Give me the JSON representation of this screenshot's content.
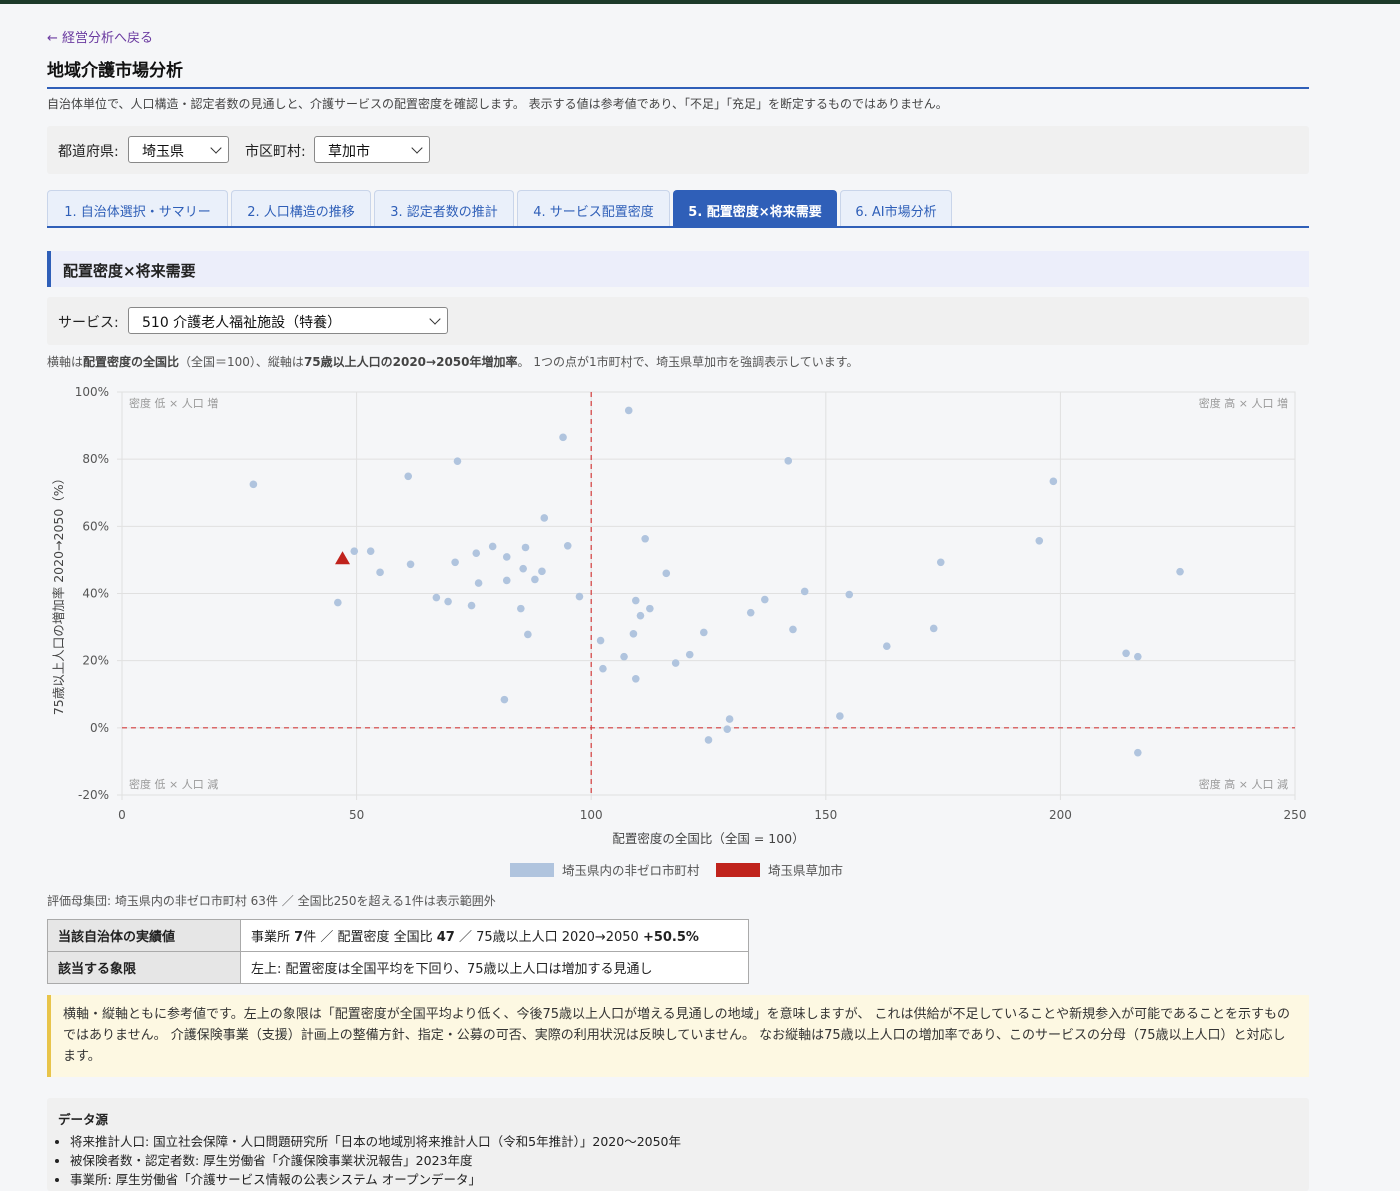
{
  "nav": {
    "back_link": "← 経営分析へ戻る"
  },
  "page": {
    "title": "地域介護市場分析",
    "description": "自治体単位で、人口構造・認定者数の見通しと、介護サービスの配置密度を確認します。 表示する値は参考値であり、「不足」「充足」を断定するものではありません。"
  },
  "selectors": {
    "prefecture_label": "都道府県:",
    "prefecture_value": "埼玉県",
    "municipality_label": "市区町村:",
    "municipality_value": "草加市"
  },
  "tabs": [
    {
      "label": "1. 自治体選択・サマリー",
      "active": false
    },
    {
      "label": "2. 人口構造の推移",
      "active": false
    },
    {
      "label": "3. 認定者数の推計",
      "active": false
    },
    {
      "label": "4. サービス配置密度",
      "active": false
    },
    {
      "label": "5. 配置密度×将来需要",
      "active": true
    },
    {
      "label": "6. AI市場分析",
      "active": false
    }
  ],
  "section": {
    "title": "配置密度×将来需要",
    "service_label": "サービス:",
    "service_value": "510 介護老人福祉施設（特養）",
    "desc_parts": {
      "p1": "横軸は",
      "b1": "配置密度の全国比",
      "p2": "（全国＝100）、縦軸は",
      "b2": "75歳以上人口の2020→2050年増加率",
      "p3": "。 1つの点が1市町村で、埼玉県草加市を強調表示しています。"
    }
  },
  "chart_data": {
    "type": "scatter",
    "xlabel": "配置密度の全国比（全国 = 100）",
    "ylabel": "75歳以上人口の増加率 2020→2050（%）",
    "xlim": [
      0,
      250
    ],
    "ylim": [
      -20,
      100
    ],
    "xticks": [
      "0",
      "50",
      "100",
      "150",
      "200",
      "250"
    ],
    "yticks": [
      "-20%",
      "0%",
      "20%",
      "40%",
      "60%",
      "80%",
      "100%"
    ],
    "grid": true,
    "legend_position": "bottom-center",
    "reference_lines": {
      "x": 100,
      "y": 0
    },
    "quadrant_labels": {
      "top_left": "密度 低 × 人口 増",
      "top_right": "密度 高 × 人口 増",
      "bottom_left": "密度 低 × 人口 減",
      "bottom_right": "密度 高 × 人口 減"
    },
    "colors": {
      "others": "#b0c4de",
      "highlight": "#c0231d",
      "reference": "#d43c3c"
    },
    "series": [
      {
        "name": "埼玉県内の非ゼロ市町村",
        "points": [
          [
            28,
            72.5
          ],
          [
            46,
            37.3
          ],
          [
            49.5,
            52.6
          ],
          [
            53,
            52.6
          ],
          [
            55,
            46.3
          ],
          [
            61,
            74.9
          ],
          [
            61.5,
            48.7
          ],
          [
            67,
            38.8
          ],
          [
            69.5,
            37.6
          ],
          [
            71,
            49.3
          ],
          [
            71.5,
            79.4
          ],
          [
            74.5,
            36.4
          ],
          [
            75.5,
            52
          ],
          [
            76,
            43.1
          ],
          [
            79,
            54
          ],
          [
            81.5,
            8.4
          ],
          [
            82,
            50.9
          ],
          [
            82,
            43.9
          ],
          [
            85,
            35.5
          ],
          [
            85.5,
            47.4
          ],
          [
            86,
            53.7
          ],
          [
            86.5,
            27.8
          ],
          [
            88,
            44.2
          ],
          [
            89.5,
            46.6
          ],
          [
            90,
            62.5
          ],
          [
            94,
            86.5
          ],
          [
            95,
            54.2
          ],
          [
            97.5,
            39.1
          ],
          [
            102,
            26
          ],
          [
            102.5,
            17.6
          ],
          [
            107,
            21.2
          ],
          [
            108,
            94.5
          ],
          [
            109,
            28
          ],
          [
            109.5,
            14.6
          ],
          [
            109.5,
            37.9
          ],
          [
            110.5,
            33.4
          ],
          [
            111.5,
            56.3
          ],
          [
            112.5,
            35.5
          ],
          [
            116,
            46
          ],
          [
            118,
            19.3
          ],
          [
            121,
            21.8
          ],
          [
            124,
            28.4
          ],
          [
            125,
            -3.6
          ],
          [
            129,
            -0.4
          ],
          [
            129.5,
            2.6
          ],
          [
            134,
            34.3
          ],
          [
            137,
            38.2
          ],
          [
            142,
            79.5
          ],
          [
            143,
            29.3
          ],
          [
            145.5,
            40.6
          ],
          [
            153,
            3.5
          ],
          [
            155,
            39.7
          ],
          [
            163,
            24.3
          ],
          [
            173,
            29.6
          ],
          [
            174.5,
            49.3
          ],
          [
            195.5,
            55.7
          ],
          [
            198.5,
            73.4
          ],
          [
            214,
            22.2
          ],
          [
            216.5,
            -7.4
          ],
          [
            216.5,
            21.2
          ],
          [
            225.5,
            46.5
          ]
        ]
      },
      {
        "name": "埼玉県草加市",
        "points": [
          [
            47,
            50.5
          ]
        ]
      }
    ]
  },
  "evaluation_note": "評価母集団: 埼玉県内の非ゼロ市町村 63件 ／ 全国比250を超える1件は表示範囲外",
  "summary": {
    "row1_header": "当該自治体の実績値",
    "row1_v1": "事業所 ",
    "row1_v2": "7",
    "row1_v3": "件 ／ 配置密度 全国比 ",
    "row1_v4": "47",
    "row1_v5": " ／ 75歳以上人口 2020→2050 ",
    "row1_v6": "+50.5%",
    "row2_header": "該当する象限",
    "row2_value": "左上: 配置密度は全国平均を下回り、75歳以上人口は増加する見通し"
  },
  "warning": "横軸・縦軸ともに参考値です。左上の象限は「配置密度が全国平均より低く、今後75歳以上人口が増える見通しの地域」を意味しますが、 これは供給が不足していることや新規参入が可能であることを示すものではありません。 介護保険事業（支援）計画上の整備方針、指定・公募の可否、実際の利用状況は反映していません。 なお縦軸は75歳以上人口の増加率であり、このサービスの分母（75歳以上人口）と対応します。",
  "sources": {
    "title": "データ源",
    "items": [
      "将来推計人口: 国立社会保障・人口問題研究所「日本の地域別将来推計人口（令和5年推計）」2020〜2050年",
      "被保険者数・認定者数: 厚生労働省「介護保険事業状況報告」2023年度",
      "事業所: 厚生労働省「介護サービス情報の公表システム オープンデータ」"
    ]
  }
}
